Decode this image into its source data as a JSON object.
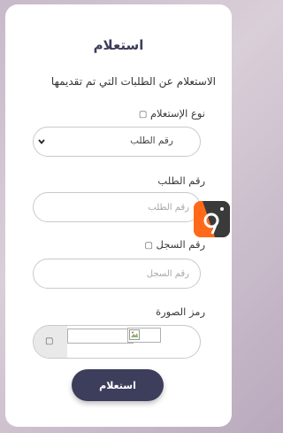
{
  "form": {
    "title": "استعلام",
    "subtitle": "الاستعلام عن الطلبات التي تم تقديمها",
    "inquiry_type": {
      "label": "نوع الإستعلام",
      "selected": "رقم الطلب"
    },
    "request_number": {
      "label": "رقم الطلب",
      "placeholder": "رقم الطلب"
    },
    "record_number": {
      "label": "رقم السجل",
      "placeholder": "رقم السجل"
    },
    "captcha": {
      "label": "رمز الصورة"
    },
    "submit_label": "استعلام"
  },
  "colors": {
    "accent": "#3d3d5c",
    "floating_button": "#ff6a1a"
  },
  "icons": {
    "info": "info-icon",
    "refresh": "refresh-icon",
    "chevron": "chevron-down-icon",
    "floating": "camera-app-icon"
  }
}
